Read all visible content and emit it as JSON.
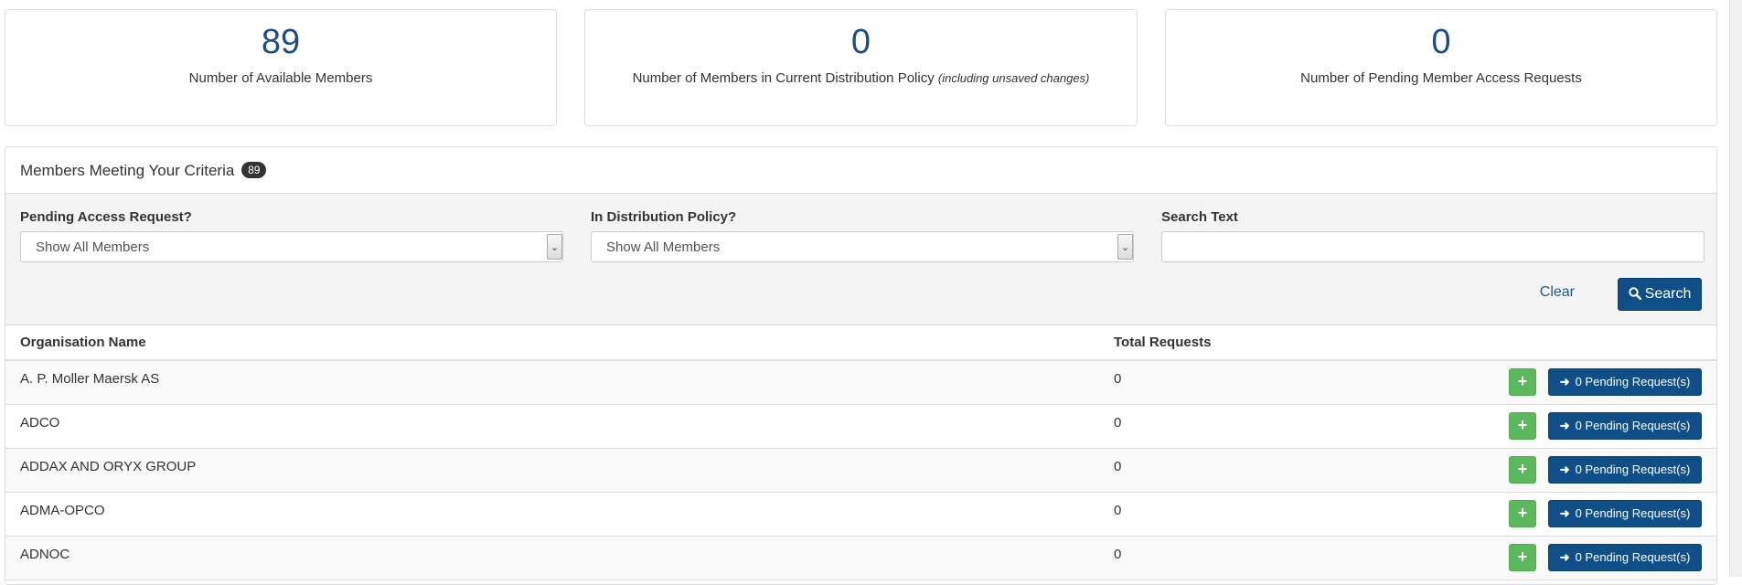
{
  "stats": [
    {
      "number": "89",
      "label": "Number of Available Members",
      "note": ""
    },
    {
      "number": "0",
      "label": "Number of Members in Current Distribution Policy",
      "note": "(including unsaved changes)"
    },
    {
      "number": "0",
      "label": "Number of Pending Member Access Requests",
      "note": ""
    }
  ],
  "panel": {
    "title": "Members Meeting Your Criteria",
    "count_badge": "89"
  },
  "filters": {
    "pending_access": {
      "label": "Pending Access Request?",
      "value": "Show All Members"
    },
    "in_policy": {
      "label": "In Distribution Policy?",
      "value": "Show All Members"
    },
    "search": {
      "label": "Search Text",
      "value": ""
    },
    "clear_label": "Clear",
    "search_button": "Search"
  },
  "table": {
    "columns": [
      "Organisation Name",
      "Total Requests"
    ],
    "rows": [
      {
        "name": "A. P. Moller Maersk AS",
        "total": "0",
        "add": "+",
        "pending": "0 Pending Request(s)"
      },
      {
        "name": "ADCO",
        "total": "0",
        "add": "+",
        "pending": "0 Pending Request(s)"
      },
      {
        "name": "ADDAX AND ORYX GROUP",
        "total": "0",
        "add": "+",
        "pending": "0 Pending Request(s)"
      },
      {
        "name": "ADMA-OPCO",
        "total": "0",
        "add": "+",
        "pending": "0 Pending Request(s)"
      },
      {
        "name": "ADNOC",
        "total": "0",
        "add": "+",
        "pending": "0 Pending Request(s)"
      }
    ]
  },
  "icons": {
    "search": "search-icon",
    "arrow": "arrow-right-icon",
    "add": "plus-icon",
    "dropdown": "chevron-down-icon"
  },
  "colors": {
    "accent": "#0f4e86",
    "success": "#5cb85c",
    "number": "#1a4f84"
  }
}
